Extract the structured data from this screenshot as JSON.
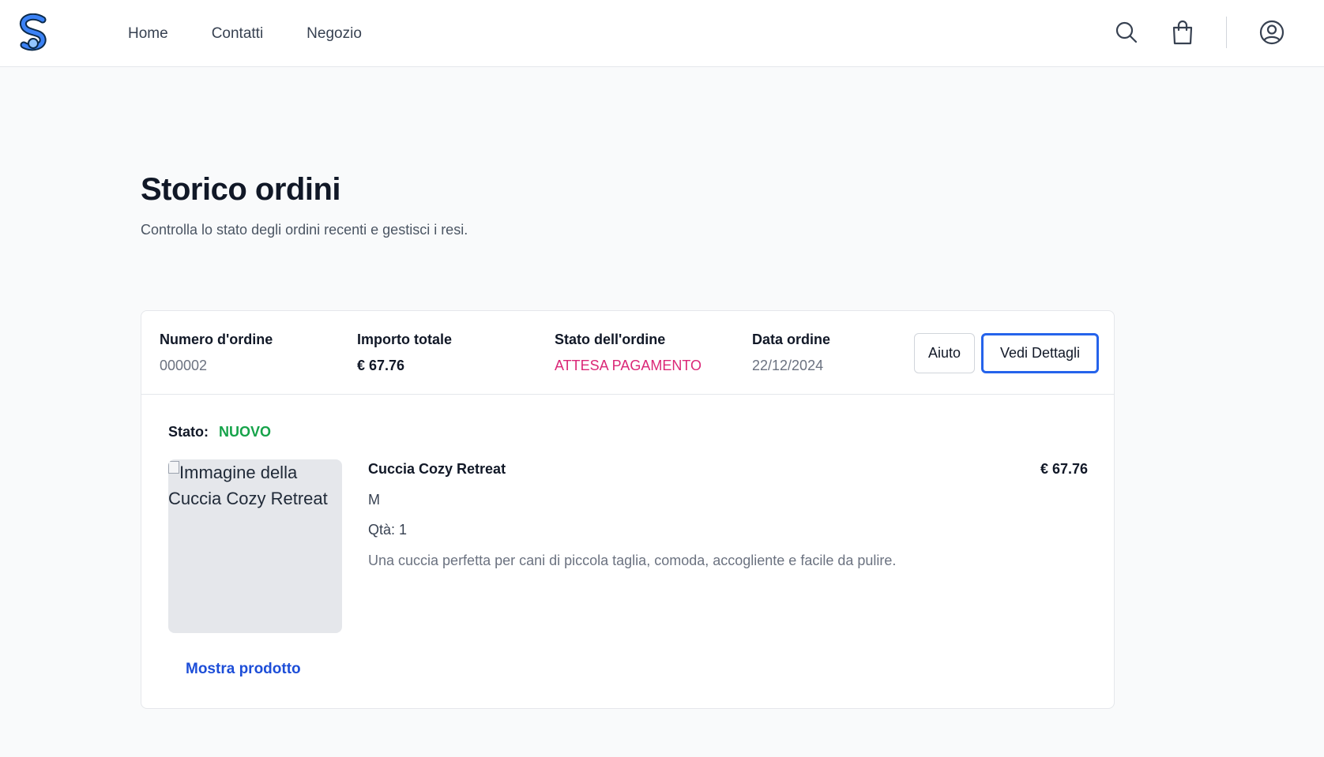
{
  "header": {
    "nav": [
      "Home",
      "Contatti",
      "Negozio"
    ],
    "icons": [
      "logo-s-icon",
      "search-icon",
      "shopping-bag-icon",
      "user-circle-icon"
    ]
  },
  "page": {
    "title": "Storico ordini",
    "subtitle": "Controlla lo stato degli ordini recenti e gestisci i resi."
  },
  "order": {
    "number_label": "Numero d'ordine",
    "number": "000002",
    "total_label": "Importo totale",
    "total": "€ 67.76",
    "state_label": "Stato dell'ordine",
    "state": "ATTESA PAGAMENTO",
    "date_label": "Data ordine",
    "date": "22/12/2024",
    "help_button": "Aiuto",
    "details_button": "Vedi Dettagli",
    "status_label": "Stato:",
    "status": "NUOVO",
    "item": {
      "image_alt": "Immagine della Cuccia Cozy Retreat",
      "name": "Cuccia Cozy Retreat",
      "price": "€ 67.76",
      "size": "M",
      "qty": "Qtà: 1",
      "description": "Una cuccia perfetta per cani di piccola taglia, comoda, accogliente e facile da pulire."
    },
    "show_product": "Mostra prodotto"
  },
  "colors": {
    "accent_blue": "#2563eb",
    "link_blue": "#1d4ed8",
    "pending_pink": "#db2777",
    "new_green": "#16a34a"
  }
}
